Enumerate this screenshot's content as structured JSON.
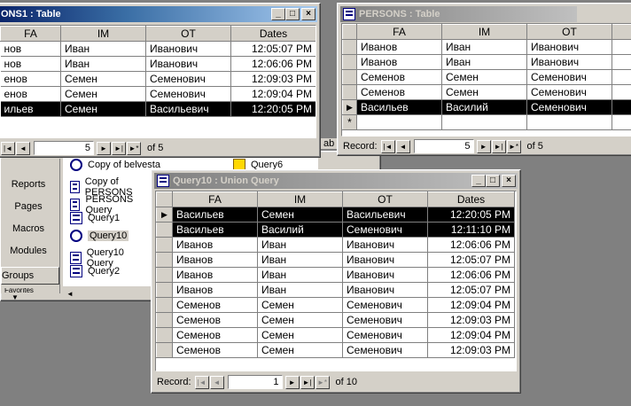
{
  "win1": {
    "title": "ONS1 : Table",
    "columns": [
      "FA",
      "IM",
      "OT",
      "Dates"
    ],
    "rows": [
      [
        "нов",
        "Иван",
        "Иванович",
        "12:05:07 PM"
      ],
      [
        "нов",
        "Иван",
        "Иванович",
        "12:06:06 PM"
      ],
      [
        "енов",
        "Семен",
        "Семенович",
        "12:09:03 PM"
      ],
      [
        "енов",
        "Семен",
        "Семенович",
        "12:09:04 PM"
      ],
      [
        "ильев",
        "Семен",
        "Васильевич",
        "12:20:05 PM"
      ]
    ],
    "record": "5",
    "of": "of  5"
  },
  "win2": {
    "title": "PERSONS : Table",
    "columns": [
      "FA",
      "IM",
      "OT"
    ],
    "rows": [
      [
        "Иванов",
        "Иван",
        "Иванович"
      ],
      [
        "Иванов",
        "Иван",
        "Иванович"
      ],
      [
        "Семенов",
        "Семен",
        "Семенович"
      ],
      [
        "Семенов",
        "Семен",
        "Семенович"
      ],
      [
        "Васильев",
        "Василий",
        "Семенович"
      ]
    ],
    "record_label": "Record:",
    "record": "5",
    "of": "of  5",
    "new_row_marker": "*"
  },
  "db": {
    "objects": [
      "Reports",
      "Pages",
      "Macros",
      "Modules"
    ],
    "groups": "Groups",
    "favorites": "Favorites",
    "items_col1": [
      "Copy of belvesta",
      "Copy of PERSONS",
      "PERSONS Query",
      "Query1",
      "Query10",
      "Query10 Query",
      "Query2"
    ],
    "items_col2": [
      "Query6"
    ],
    "cut_text": "ab"
  },
  "win3": {
    "title": "Query10 : Union Query",
    "columns": [
      "FA",
      "IM",
      "OT",
      "Dates"
    ],
    "rows": [
      [
        "Васильев",
        "Семен",
        "Васильевич",
        "12:20:05 PM"
      ],
      [
        "Васильев",
        "Василий",
        "Семенович",
        "12:11:10 PM"
      ],
      [
        "Иванов",
        "Иван",
        "Иванович",
        "12:06:06 PM"
      ],
      [
        "Иванов",
        "Иван",
        "Иванович",
        "12:05:07 PM"
      ],
      [
        "Иванов",
        "Иван",
        "Иванович",
        "12:06:06 PM"
      ],
      [
        "Иванов",
        "Иван",
        "Иванович",
        "12:05:07 PM"
      ],
      [
        "Семенов",
        "Семен",
        "Семенович",
        "12:09:04 PM"
      ],
      [
        "Семенов",
        "Семен",
        "Семенович",
        "12:09:03 PM"
      ],
      [
        "Семенов",
        "Семен",
        "Семенович",
        "12:09:04 PM"
      ],
      [
        "Семенов",
        "Семен",
        "Семенович",
        "12:09:03 PM"
      ]
    ],
    "record_label": "Record:",
    "record": "1",
    "of": "of  10"
  }
}
